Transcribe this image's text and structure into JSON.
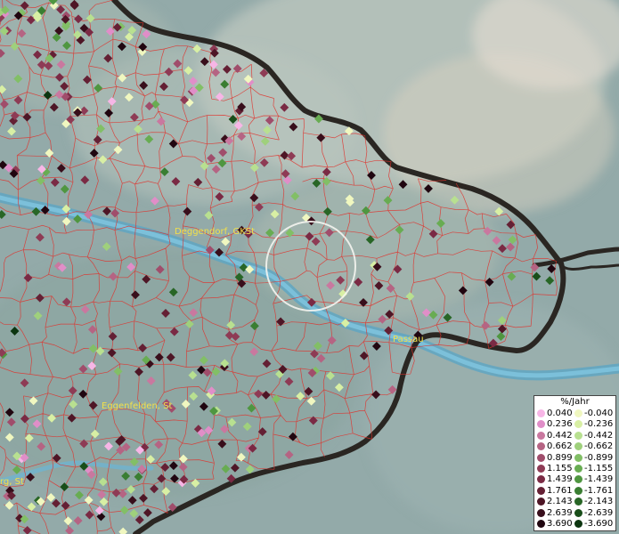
{
  "map": {
    "places": [
      {
        "name": "Deggendorf, GKSt"
      },
      {
        "name": "Passau"
      },
      {
        "name": "Eggenfelden, St"
      },
      {
        "name": "rg, St"
      }
    ]
  },
  "legend": {
    "title": "%/Jahr",
    "positive": [
      "0.040",
      "0.236",
      "0.442",
      "0.662",
      "0.899",
      "1.155",
      "1.439",
      "1.761",
      "2.143",
      "2.639",
      "3.690"
    ],
    "negative": [
      "-0.040",
      "-0.236",
      "-0.442",
      "-0.662",
      "-0.899",
      "-1.155",
      "-1.439",
      "-1.761",
      "-2.143",
      "-2.639",
      "-3.690"
    ],
    "positive_colors": [
      "#f7b6e6",
      "#e08ec8",
      "#c9789f",
      "#b56483",
      "#a04d6b",
      "#8e3b55",
      "#7a2a44",
      "#642034",
      "#4e1626",
      "#380e1b",
      "#200610"
    ],
    "negative_colors": [
      "#f0f7c0",
      "#d8efa4",
      "#b8e090",
      "#9fd07c",
      "#82bf66",
      "#68ac52",
      "#4f9640",
      "#3a7e32",
      "#286626",
      "#194e1a",
      "#0c3510"
    ]
  }
}
